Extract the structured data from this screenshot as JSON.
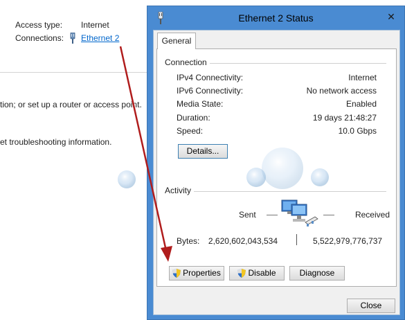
{
  "background": {
    "access_type_label": "Access type:",
    "access_type_value": "Internet",
    "connections_label": "Connections:",
    "connections_link": "Ethernet 2",
    "line1": "tion; or set up a router or access point.",
    "line2": "et troubleshooting information."
  },
  "dialog": {
    "title": "Ethernet 2 Status",
    "tab_general": "General",
    "connection_group": "Connection",
    "properties": [
      {
        "label": "IPv4 Connectivity:",
        "value": "Internet"
      },
      {
        "label": "IPv6 Connectivity:",
        "value": "No network access"
      },
      {
        "label": "Media State:",
        "value": "Enabled"
      },
      {
        "label": "Duration:",
        "value": "19 days 21:48:27"
      },
      {
        "label": "Speed:",
        "value": "10.0 Gbps"
      }
    ],
    "details_button": "Details...",
    "activity_group": "Activity",
    "sent_label": "Sent",
    "received_label": "Received",
    "bytes_label": "Bytes:",
    "bytes_sent": "2,620,602,043,534",
    "bytes_received": "5,522,979,776,737",
    "properties_button": "Properties",
    "disable_button": "Disable",
    "diagnose_button": "Diagnose",
    "close_button": "Close",
    "close_x": "✕"
  },
  "colors": {
    "window_frame": "#4a8bd2",
    "link": "#0066cc",
    "arrow": "#b01c1c"
  },
  "icons": [
    "ethernet-connection-icon",
    "network-computers-icon",
    "uac-shield-icon",
    "window-close-icon"
  ]
}
